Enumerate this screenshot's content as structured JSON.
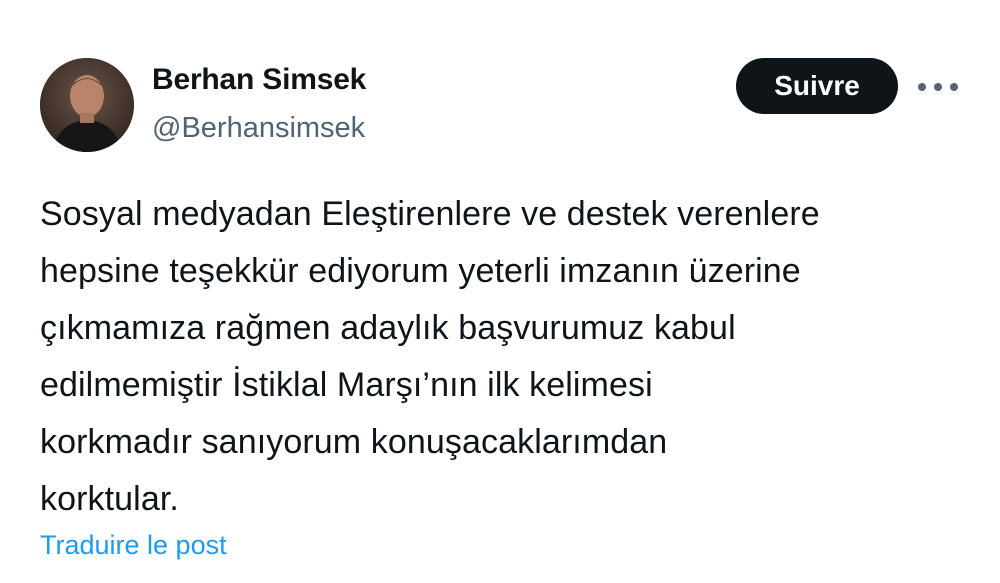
{
  "author": {
    "display_name": "Berhan Simsek",
    "handle": "@Berhansimsek",
    "avatar_icon": "profile-photo"
  },
  "actions": {
    "follow_label": "Suivre",
    "more_icon": "ellipsis-horizontal-icon"
  },
  "tweet": {
    "lines": [
      "Sosyal medyadan Eleştirenlere ve destek verenlere",
      "hepsine teşekkür ediyorum yeterli imzanın üzerine",
      "çıkmamıza rağmen adaylık başvurumuz kabul",
      "edilmemiştir İstiklal Marşı’nın ilk kelimesi",
      "korkmadır sanıyorum konuşacaklarımdan",
      "korktular."
    ],
    "translate_label": "Traduire le post"
  },
  "colors": {
    "text": "#0f1419",
    "secondary": "#536471",
    "link": "#1d9bf0",
    "button_bg": "#0f1419"
  }
}
